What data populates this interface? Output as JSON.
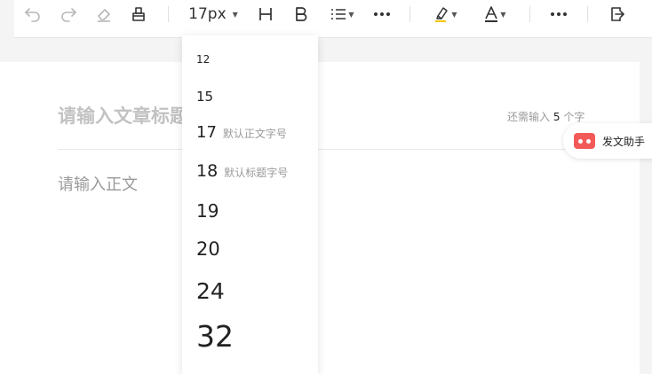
{
  "toolbar": {
    "font_size_value": "17px",
    "icons": [
      "undo-icon",
      "redo-icon",
      "eraser-icon",
      "format-painter-icon",
      "heading-icon",
      "bold-icon",
      "list-icon",
      "more-icon",
      "highlight-icon",
      "font-color-icon",
      "more-icon",
      "export-icon"
    ],
    "highlight_color": "#f5c400"
  },
  "editor": {
    "title_placeholder": "请输入文章标题",
    "title_paren": ")",
    "counter_prefix": "还需输入",
    "counter_value": "5",
    "counter_suffix": "个字",
    "body_placeholder": "请输入正文"
  },
  "assistant": {
    "label": "发文助手",
    "color": "#f25a5a"
  },
  "font_size_menu": {
    "options": [
      {
        "value": "12",
        "hint": ""
      },
      {
        "value": "15",
        "hint": ""
      },
      {
        "value": "17",
        "hint": "默认正文字号"
      },
      {
        "value": "18",
        "hint": "默认标题字号"
      },
      {
        "value": "19",
        "hint": ""
      },
      {
        "value": "20",
        "hint": ""
      },
      {
        "value": "24",
        "hint": ""
      },
      {
        "value": "32",
        "hint": ""
      }
    ]
  }
}
